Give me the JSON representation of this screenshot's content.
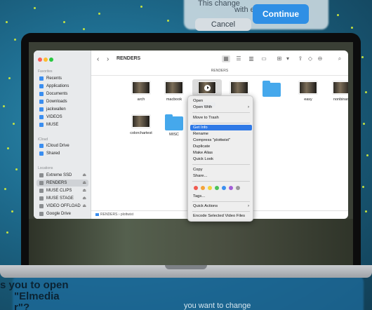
{
  "background": {
    "top_dialog": {
      "line1": "This change",
      "line2": "with extension",
      "cancel": "Cancel",
      "continue": "Continue"
    },
    "bottom_text": [
      "s you to open",
      "\"Elmedia",
      "r\"?",
      "you want to change"
    ]
  },
  "finder": {
    "title": "RENDERS",
    "path_header": "RENDERS",
    "sidebar": {
      "favorites_header": "Favorites",
      "favorites": [
        "Recents",
        "Applications",
        "Documents",
        "Downloads",
        "jackwallen",
        "VIDEOS",
        "MUSE"
      ],
      "icloud_header": "iCloud",
      "icloud": [
        "iCloud Drive",
        "Shared"
      ],
      "locations_header": "Locations",
      "locations": [
        "Extreme SSD",
        "RENDERS",
        "MUSE CLIPS",
        "MUSE STAGE",
        "VIDEO OFFLOAD",
        "Google Drive"
      ],
      "selected": "RENDERS"
    },
    "toolbar": {
      "back": "‹",
      "forward": "›"
    },
    "files": [
      "arch",
      "macbook",
      "plottwist",
      "",
      "",
      "easy",
      "nonbinary",
      "colorchartest",
      "MISC"
    ],
    "selected_file": "plottwist",
    "pathbar": {
      "root": "RENDERS",
      "sep": "›",
      "item": "plottwist"
    }
  },
  "context_menu": {
    "items": [
      {
        "label": "Open"
      },
      {
        "label": "Open With",
        "submenu": true
      },
      {
        "label": "Move to Trash"
      },
      {
        "label": "Get Info",
        "highlighted": true
      },
      {
        "label": "Rename"
      },
      {
        "label": "Compress \"plottwist\""
      },
      {
        "label": "Duplicate"
      },
      {
        "label": "Make Alias"
      },
      {
        "label": "Quick Look"
      },
      {
        "label": "Copy"
      },
      {
        "label": "Share..."
      },
      {
        "label": "Tags..."
      },
      {
        "label": "Quick Actions",
        "submenu": true
      },
      {
        "label": "Encode Selected Video Files"
      }
    ],
    "tag_colors": [
      "#f05a4f",
      "#f3a33a",
      "#f2d23c",
      "#4cc259",
      "#3a8ef0",
      "#a35ed8",
      "#9a9a9a"
    ],
    "submenu_arrow": "›"
  }
}
